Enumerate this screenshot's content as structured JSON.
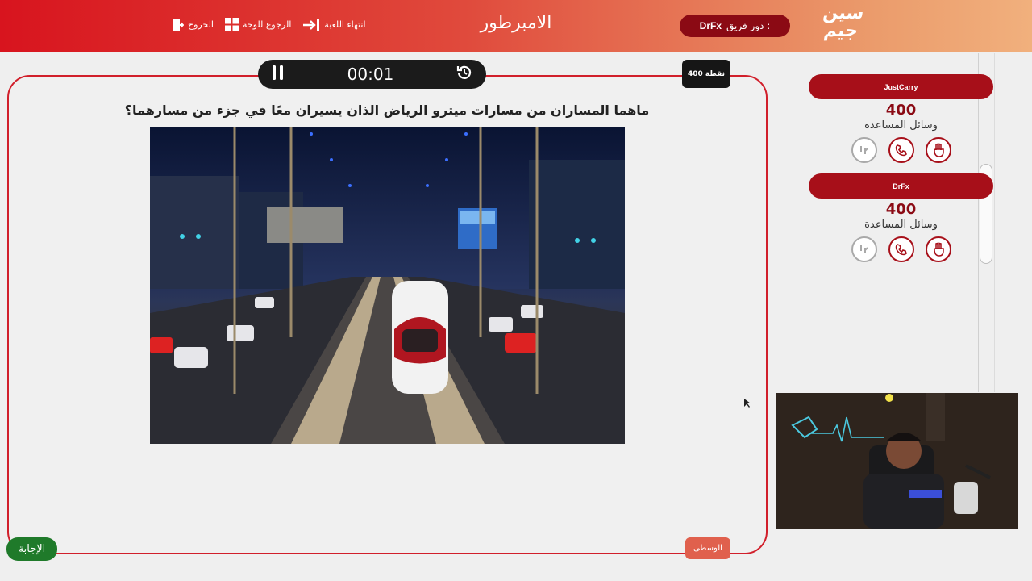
{
  "header": {
    "logo_text_line1": "سين",
    "logo_text_line2": "جيم",
    "team_turn_label": "دور فريق :",
    "team_turn_name": "DrFx",
    "game_title": "الامبرطور",
    "end_game_label": "انتهاء اللعبة",
    "back_to_board_label": "الرجوع للوحة",
    "exit_label": "الخروج",
    "colors": {
      "brand_red": "#d8141e",
      "accent_dark_red": "#8b0a14"
    }
  },
  "question": {
    "points_label": "400 نقطة",
    "timer": "00:01",
    "text": "ماهما المساران من مسارات ميترو الرياض الذان يسيران معًا في جزء من مسارهما؟",
    "image_alt": "Riyadh metro train on elevated track at night",
    "category_label": "الوسطى",
    "answer_label": "الإجابة"
  },
  "teams": [
    {
      "name": "JustCarry",
      "score": "400",
      "help_label": "وسائل المساعدة",
      "help": [
        {
          "icon": "two-answers-icon",
          "enabled": true
        },
        {
          "icon": "phone-icon",
          "enabled": true
        },
        {
          "icon": "pitstop-icon",
          "enabled": false
        }
      ]
    },
    {
      "name": "DrFx",
      "score": "400",
      "help_label": "وسائل المساعدة",
      "help": [
        {
          "icon": "two-answers-icon",
          "enabled": true
        },
        {
          "icon": "phone-icon",
          "enabled": true
        },
        {
          "icon": "pitstop-icon",
          "enabled": false
        }
      ]
    }
  ]
}
